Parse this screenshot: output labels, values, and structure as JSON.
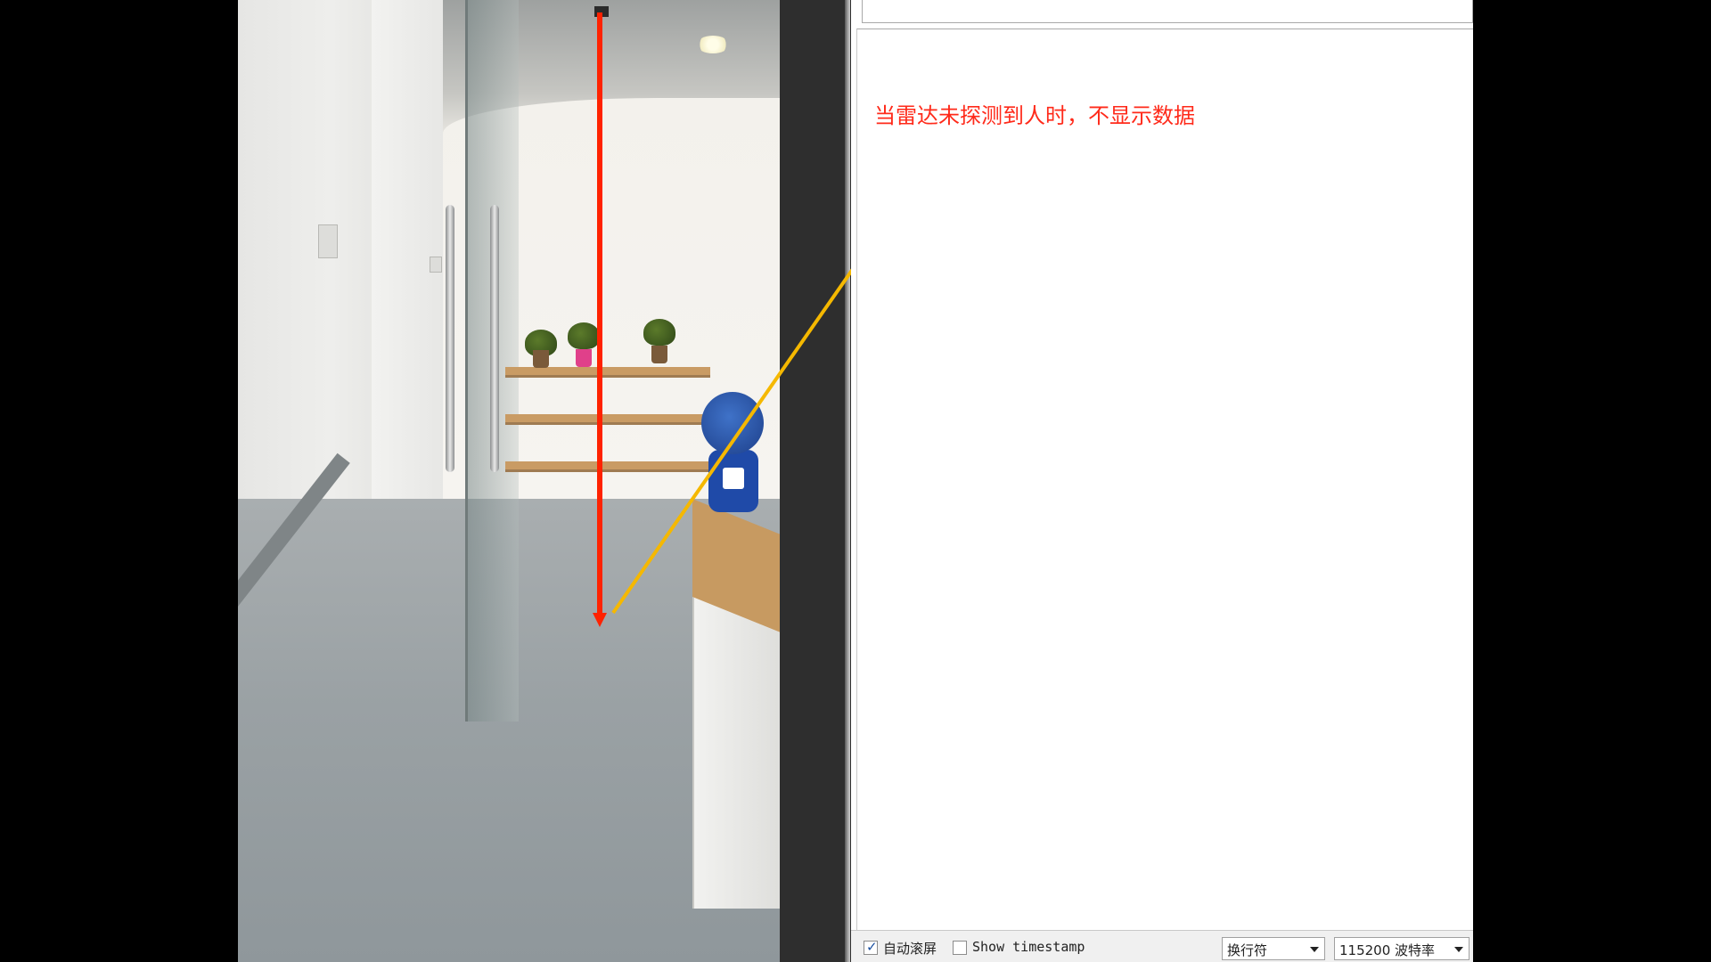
{
  "annotation": {
    "note_text": "当雷达未探测到人时，不显示数据",
    "note_color": "#ff2a1a",
    "vertical_arrow_color": "#ff2200",
    "pointer_arrow_color": "#f5b800"
  },
  "serial_monitor": {
    "send_input_value": "",
    "output_text": "",
    "autoscroll": {
      "label": "自动滚屏",
      "checked": true
    },
    "timestamp": {
      "label": "Show timestamp",
      "checked": false
    },
    "line_ending": {
      "selected": "换行符"
    },
    "baud_rate": {
      "selected": "115200 波特率"
    }
  },
  "colors": {
    "divider": "#2e2e2e",
    "monitor_bg": "#ffffff",
    "status_bar_bg": "#f0f0f0"
  },
  "icons": {
    "checkbox_check": "check-icon",
    "dropdown": "chevron-down-icon"
  }
}
